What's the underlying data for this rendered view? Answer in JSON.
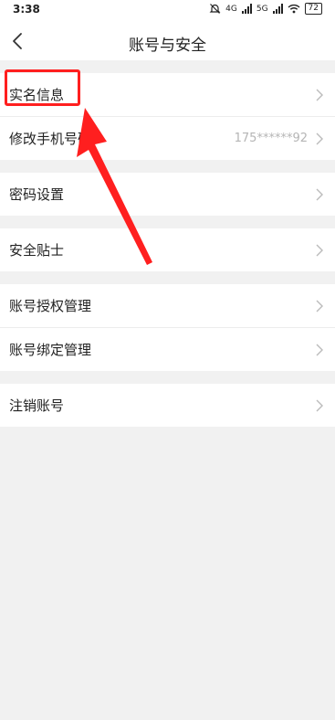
{
  "status_bar": {
    "time": "3:38",
    "network_1": "4G",
    "network_2": "5G",
    "battery": "72"
  },
  "header": {
    "title": "账号与安全"
  },
  "groups": [
    {
      "items": [
        {
          "label": "实名信息",
          "value": ""
        },
        {
          "label": "修改手机号码",
          "value": "175******92"
        }
      ]
    },
    {
      "items": [
        {
          "label": "密码设置",
          "value": ""
        }
      ]
    },
    {
      "items": [
        {
          "label": "安全贴士",
          "value": ""
        }
      ]
    },
    {
      "items": [
        {
          "label": "账号授权管理",
          "value": ""
        },
        {
          "label": "账号绑定管理",
          "value": ""
        }
      ]
    },
    {
      "items": [
        {
          "label": "注销账号",
          "value": ""
        }
      ]
    }
  ],
  "annotation_color": "#ff1f1f"
}
